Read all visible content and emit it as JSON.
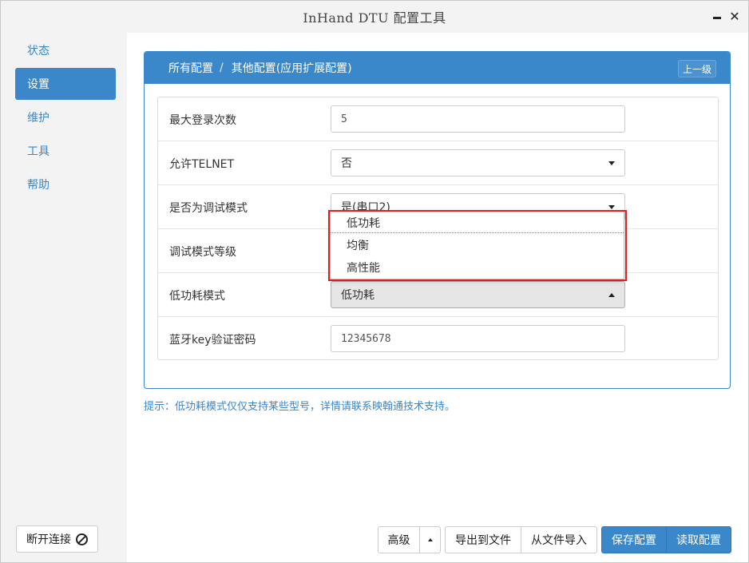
{
  "window": {
    "title": "InHand DTU 配置工具"
  },
  "sidebar": {
    "items": [
      {
        "label": "状态",
        "active": false
      },
      {
        "label": "设置",
        "active": true
      },
      {
        "label": "维护",
        "active": false
      },
      {
        "label": "工具",
        "active": false
      },
      {
        "label": "帮助",
        "active": false
      }
    ],
    "disconnect_label": "断开连接"
  },
  "panel": {
    "breadcrumb_root": "所有配置",
    "breadcrumb_sep": "/",
    "breadcrumb_current": "其他配置(应用扩展配置)",
    "up_label": "上一级"
  },
  "form": {
    "max_login": {
      "label": "最大登录次数",
      "value": "5"
    },
    "allow_telnet": {
      "label": "允许TELNET",
      "value": "否"
    },
    "debug_mode": {
      "label": "是否为调试模式",
      "value": "是(串口2)"
    },
    "debug_level": {
      "label": "调试模式等级"
    },
    "low_power": {
      "label": "低功耗模式",
      "value": "低功耗"
    },
    "bt_key": {
      "label": "蓝牙key验证密码",
      "value": "12345678"
    }
  },
  "dropdown": {
    "options": [
      "低功耗",
      "均衡",
      "高性能"
    ],
    "selected": "低功耗"
  },
  "tip": "提示：低功耗模式仅仅支持某些型号，详情请联系映翰通技术支持。",
  "footer": {
    "advanced_label": "高级",
    "export_label": "导出到文件",
    "import_label": "从文件导入",
    "save_label": "保存配置",
    "read_label": "读取配置"
  },
  "colors": {
    "accent": "#3a87c9",
    "highlight": "#e02020"
  }
}
